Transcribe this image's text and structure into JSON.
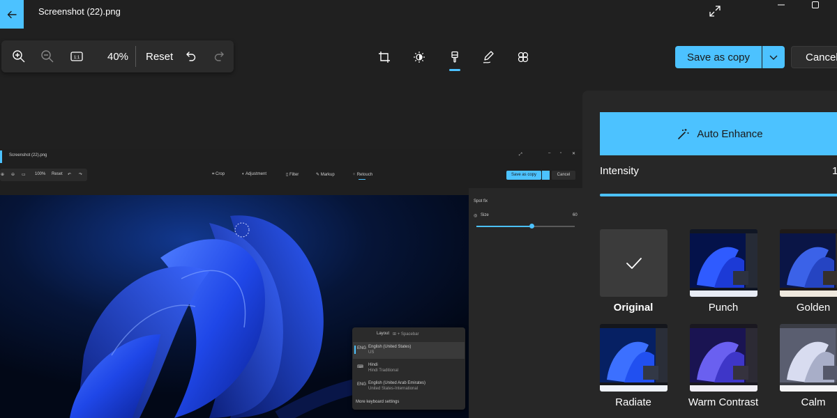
{
  "window": {
    "title": "Screenshot (22).png"
  },
  "zoom_bar": {
    "zoom_level": "40%",
    "reset_label": "Reset"
  },
  "actions": {
    "save_label": "Save as copy",
    "cancel_label": "Cancel"
  },
  "enhance": {
    "auto_enhance_label": "Auto Enhance",
    "intensity_label": "Intensity",
    "intensity_value": "1"
  },
  "filters": [
    {
      "name": "Original",
      "selected": true
    },
    {
      "name": "Punch"
    },
    {
      "name": "Golden"
    },
    {
      "name": "Radiate"
    },
    {
      "name": "Warm Contrast"
    },
    {
      "name": "Calm"
    }
  ],
  "inner_screenshot": {
    "title": "Screenshot (22).png",
    "zoom_level": "100%",
    "reset_label": "Reset",
    "tools": [
      "Crop",
      "Adjustment",
      "Filter",
      "Markup",
      "Retouch"
    ],
    "save_label": "Save as copy",
    "cancel_label": "Cancel",
    "panel_title": "Spot fix",
    "size_label": "Size",
    "size_value": "60",
    "layout_label": "Layout",
    "layout_shortcut": "⊞ + Spacebar",
    "languages": [
      {
        "code": "ENG",
        "name": "English (United States)",
        "layout": "US"
      },
      {
        "code": "",
        "name": "Hindi",
        "layout": "Hindi Traditional"
      },
      {
        "code": "ENG",
        "name": "English (United Arab Emirates)",
        "layout": "United States-International"
      }
    ],
    "more_settings": "More keyboard settings"
  },
  "colors": {
    "accent": "#4cc2ff",
    "background": "#202020",
    "panel": "#272727",
    "toolbar": "#2b2b2b"
  },
  "icons": [
    "back-arrow-icon",
    "zoom-in-icon",
    "zoom-out-icon",
    "actual-size-icon",
    "undo-icon",
    "redo-icon",
    "crop-icon",
    "brightness-icon",
    "filter-brush-icon",
    "markup-pen-icon",
    "retouch-icon",
    "expand-icon",
    "minimize-icon",
    "maximize-icon",
    "chevron-down-icon",
    "magic-wand-icon",
    "checkmark-icon"
  ]
}
